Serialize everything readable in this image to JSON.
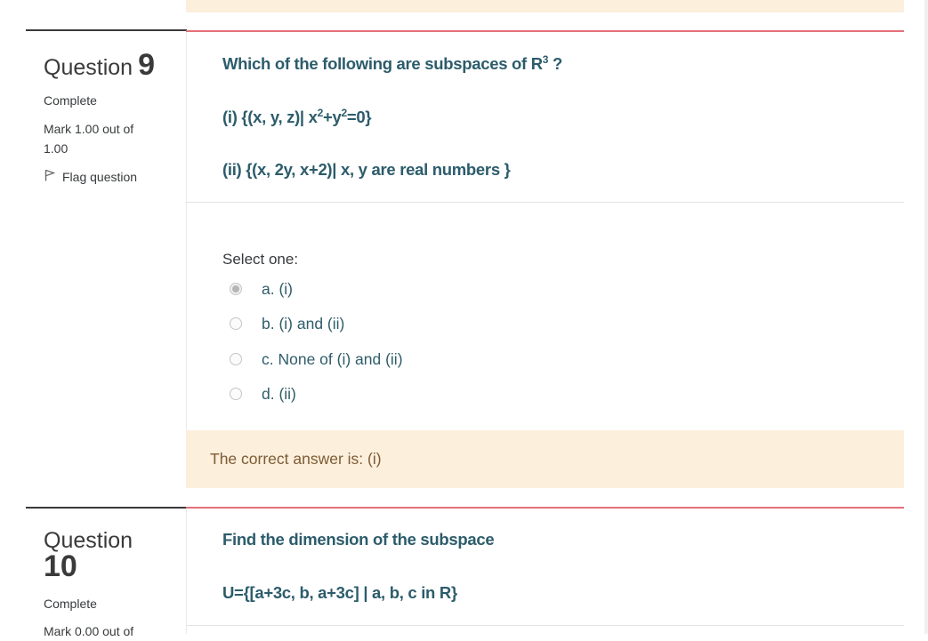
{
  "questions": [
    {
      "word": "Question",
      "number": "9",
      "state": "Complete",
      "mark": "Mark 1.00 out of 1.00",
      "flag_label": "Flag question",
      "text_line1_prefix": "Which of the following are subspaces of R",
      "text_line1_sup": "3",
      "text_line1_suffix": " ?",
      "part1_prefix": "(i) {(x, y, z)| x",
      "part1_sup1": "2",
      "part1_mid": "+y",
      "part1_sup2": "2",
      "part1_suffix": "=0}",
      "part2": "(ii) {(x, 2y, x+2)| x, y are real numbers }",
      "select_label": "Select one:",
      "options": [
        {
          "label": "a. (i)",
          "checked": true
        },
        {
          "label": "b. (i) and (ii)",
          "checked": false
        },
        {
          "label": "c. None of (i) and (ii)",
          "checked": false
        },
        {
          "label": "d. (ii)",
          "checked": false
        }
      ],
      "feedback": "The correct answer is: (i)"
    },
    {
      "word": "Question",
      "number": "10",
      "state": "Complete",
      "mark": "Mark 0.00 out of",
      "text_line1": "Find the dimension of the subspace",
      "text_line2": "U={[a+3c, b, a+3c] | a, b, c in R}"
    }
  ],
  "colors": {
    "question_text": "#2c5c6b",
    "divider_red": "#e4707a",
    "feedback_bg": "#fcefdc",
    "feedback_text": "#7d5b35"
  },
  "icons": {
    "flag": "flag-icon"
  }
}
